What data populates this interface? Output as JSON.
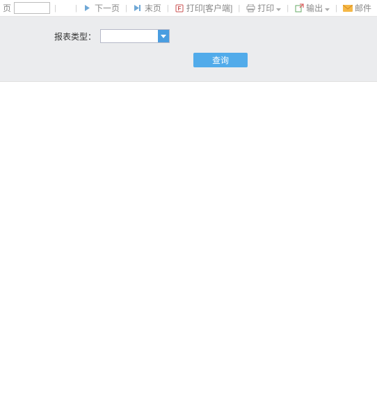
{
  "toolbar": {
    "page_fragment": "页",
    "page_value": "",
    "next_page": "下一页",
    "last_page": "末页",
    "print_client": "打印[客户端]",
    "print": "打印",
    "export": "输出",
    "mail": "邮件"
  },
  "filter": {
    "report_type_label": "报表类型：",
    "report_type_value": "",
    "query_label": "查询"
  },
  "colors": {
    "accent": "#51abea",
    "toolbar_text": "#888",
    "sep": "#ccc"
  }
}
